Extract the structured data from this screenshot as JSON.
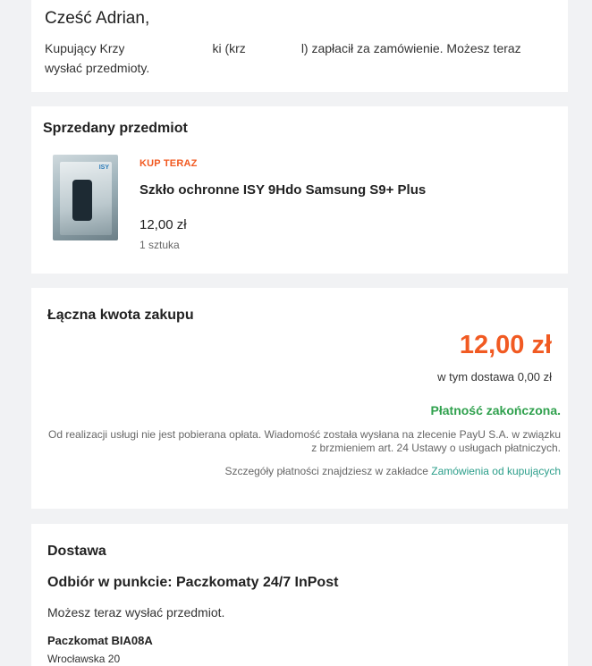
{
  "greeting": {
    "title": "Cześć Adrian,",
    "text_part1": "Kupujący Krzy",
    "text_part2": "ki (krz",
    "text_part3": "l) zapłacił za zamówienie. Możesz teraz wysłać przedmioty."
  },
  "sold_item": {
    "heading": "Sprzedany przedmiot",
    "thumbnail_icon": "product-photo",
    "thumbnail_brand": "ISY",
    "badge": "KUP TERAZ",
    "name": "Szkło ochronne ISY 9Hdo Samsung S9+ Plus",
    "price": "12,00 zł",
    "quantity": "1 sztuka"
  },
  "total": {
    "heading": "Łączna kwota zakupu",
    "amount": "12,00 zł",
    "delivery_note": "w tym dostawa 0,00 zł",
    "status": "Płatność zakończona.",
    "note": "Od realizacji usługi nie jest pobierana opłata. Wiadomość została wysłana na zlecenie PayU S.A. w związku z brzmieniem art. 24 Ustawy o usługach płatniczych.",
    "details_prefix": "Szczegóły płatności znajdziesz w zakładce",
    "details_link": "Zamówienia od kupujących"
  },
  "delivery": {
    "heading": "Dostawa",
    "method": "Odbiór w punkcie: Paczkomaty 24/7 InPost",
    "text": "Możesz teraz wysłać przedmiot.",
    "locker_name": "Paczkomat BIA08A",
    "locker_address": "Wrocławska 20"
  },
  "colors": {
    "background": "#f1f2f4",
    "accent_orange": "#f15a22",
    "success_green": "#30a14e",
    "link_teal": "#2b9e8a"
  }
}
